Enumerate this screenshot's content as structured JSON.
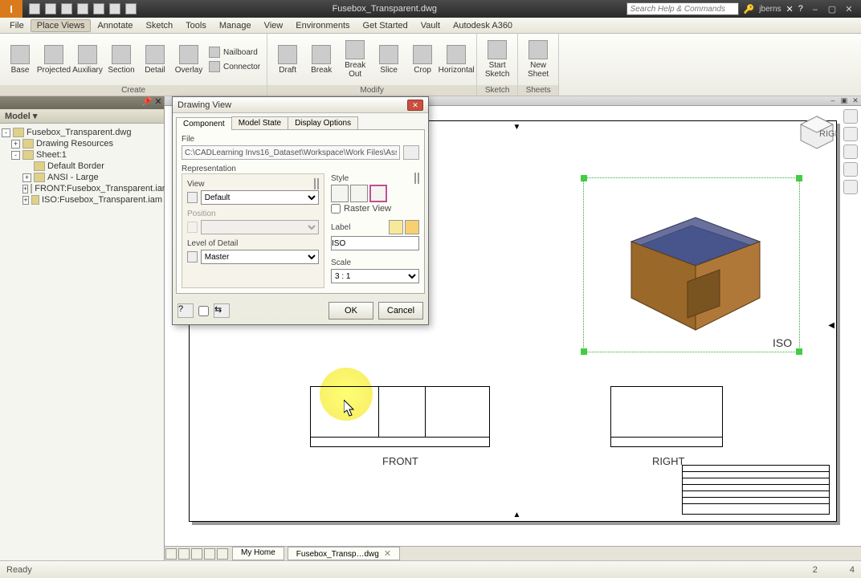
{
  "app": {
    "filename": "Fusebox_Transparent.dwg",
    "search_placeholder": "Search Help & Commands",
    "user": "jberns"
  },
  "menu": [
    "File",
    "Place Views",
    "Annotate",
    "Sketch",
    "Tools",
    "Manage",
    "View",
    "Environments",
    "Get Started",
    "Vault",
    "Autodesk A360"
  ],
  "menu_active": 1,
  "ribbon": {
    "groups": [
      {
        "label": "Create",
        "large": [
          "Base",
          "Projected",
          "Auxiliary",
          "Section",
          "Detail",
          "Overlay"
        ],
        "small": [
          "Nailboard",
          "Connector"
        ]
      },
      {
        "label": "Modify",
        "large": [
          "Draft",
          "Break",
          "Break Out",
          "Slice",
          "Crop",
          "Horizontal"
        ]
      },
      {
        "label": "Sketch",
        "large": [
          "Start Sketch"
        ]
      },
      {
        "label": "Sheets",
        "large": [
          "New Sheet"
        ]
      }
    ]
  },
  "browser": {
    "title": "Model ▾",
    "tree": [
      {
        "d": 0,
        "exp": "-",
        "ic": 1,
        "t": "Fusebox_Transparent.dwg"
      },
      {
        "d": 1,
        "exp": "+",
        "ic": 1,
        "t": "Drawing Resources"
      },
      {
        "d": 1,
        "exp": "-",
        "ic": 1,
        "t": "Sheet:1"
      },
      {
        "d": 2,
        "exp": "",
        "ic": 1,
        "t": "Default Border"
      },
      {
        "d": 2,
        "exp": "+",
        "ic": 1,
        "t": "ANSI - Large"
      },
      {
        "d": 2,
        "exp": "+",
        "ic": 1,
        "t": "FRONT:Fusebox_Transparent.iam"
      },
      {
        "d": 2,
        "exp": "+",
        "ic": 1,
        "t": "ISO:Fusebox_Transparent.iam"
      }
    ]
  },
  "dialog": {
    "title": "Drawing View",
    "tabs": [
      "Component",
      "Model State",
      "Display Options"
    ],
    "tab_active": 0,
    "file_label": "File",
    "file_path": "C:\\CADLearning Invs16_Dataset\\Workspace\\Work Files\\Asse",
    "rep_label": "Representation",
    "view_label": "View",
    "view_value": "Default",
    "pos_label": "Position",
    "lod_label": "Level of Detail",
    "lod_value": "Master",
    "style_label": "Style",
    "raster_label": "Raster View",
    "label_label": "Label",
    "label_value": "ISO",
    "scale_label": "Scale",
    "scale_value": "3 : 1",
    "ok": "OK",
    "cancel": "Cancel"
  },
  "views": {
    "front": "FRONT",
    "right": "RIGHT",
    "iso": "ISO"
  },
  "doc_tabs": [
    "My Home",
    "Fusebox_Transp…dwg"
  ],
  "status": {
    "left": "Ready",
    "r1": "2",
    "r2": "4"
  }
}
